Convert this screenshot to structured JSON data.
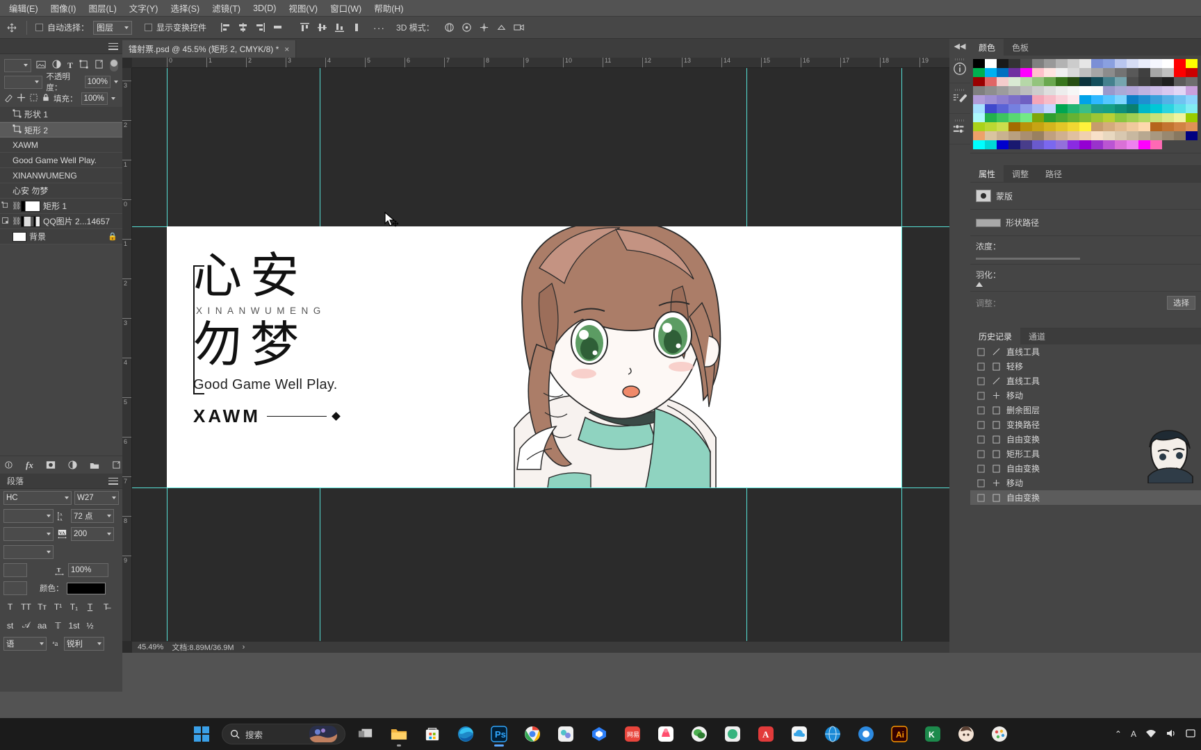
{
  "menubar": {
    "items": [
      {
        "label": "编辑(E)"
      },
      {
        "label": "图像(I)"
      },
      {
        "label": "图层(L)"
      },
      {
        "label": "文字(Y)"
      },
      {
        "label": "选择(S)"
      },
      {
        "label": "滤镜(T)"
      },
      {
        "label": "3D(D)"
      },
      {
        "label": "视图(V)"
      },
      {
        "label": "窗口(W)"
      },
      {
        "label": "帮助(H)"
      }
    ]
  },
  "options_bar": {
    "auto_select_label": "自动选择：",
    "auto_select_value": "图层",
    "show_transform_label": "显示变换控件",
    "mode_3d_label": "3D 模式：",
    "dots_label": "···"
  },
  "document_tab": {
    "title": "镭射票.psd @ 45.5% (矩形 2, CMYK/8) *",
    "close_label": "×"
  },
  "layers_panel": {
    "opacity_label": "不透明度：",
    "opacity_value": "100%",
    "fill_label": "填充：",
    "fill_value": "100%",
    "kind_value": "",
    "items": [
      {
        "name": "形状 1",
        "type": "shape",
        "locked": false
      },
      {
        "name": "矩形 2",
        "type": "shape",
        "selected": true,
        "locked": false
      },
      {
        "name": "XAWM",
        "type": "text",
        "locked": false
      },
      {
        "name": "Good Game Well Play.",
        "type": "text",
        "locked": false
      },
      {
        "name": "XINANWUMENG",
        "type": "text",
        "locked": false
      },
      {
        "name": "心安 勿梦",
        "type": "text",
        "locked": false
      },
      {
        "name": "矩形 1",
        "type": "shape-mask",
        "locked": false
      },
      {
        "name": "QQ图片 2...14657",
        "type": "image-mask",
        "locked": false
      },
      {
        "name": "背景",
        "type": "background",
        "locked": true
      }
    ]
  },
  "character_panel": {
    "tabs": [
      {
        "label": "段落",
        "active": false
      }
    ],
    "font_family": "HC",
    "font_style": "W27",
    "font_size_value": "72 点",
    "tracking_value": "200",
    "vertical_scale_value": "100%",
    "color_label": "颜色：",
    "color_value": "#000000",
    "anti_alias_value": "锐利",
    "language_value": "语",
    "style_buttons": [
      "T",
      "TT",
      "Tᴛ",
      "T¹",
      "T₁",
      "T",
      "T̶"
    ],
    "style_buttons2": [
      "st",
      "𝒜",
      "aa",
      "𝕋",
      "1st",
      "½"
    ]
  },
  "canvas": {
    "zoom_label": "45.49%",
    "doc_size_label": "文档:8.89M/36.9M",
    "ruler_h_ticks": [
      "0",
      "1",
      "2",
      "3",
      "4",
      "5",
      "6",
      "7",
      "8",
      "9",
      "10",
      "11",
      "12",
      "13",
      "14",
      "15",
      "16",
      "17",
      "18",
      "19"
    ],
    "ruler_v_ticks": [
      "3",
      "2",
      "1",
      "0",
      "1",
      "2",
      "3",
      "4",
      "5",
      "6",
      "7",
      "8",
      "9"
    ]
  },
  "artwork": {
    "title_line1": "心安",
    "title_line2": "勿梦",
    "pinyin": "XINANWUMENG",
    "tagline": "Good Game Well Play.",
    "brand": "XAWM"
  },
  "right_dock": {
    "color_tabs": [
      {
        "label": "颜色",
        "active": true
      },
      {
        "label": "色板",
        "active": false
      }
    ],
    "properties_tabs": [
      {
        "label": "属性",
        "active": true
      },
      {
        "label": "调整",
        "active": false
      },
      {
        "label": "路径",
        "active": false
      }
    ],
    "properties": {
      "mask_label": "蒙版",
      "path_label": "形状路径",
      "density_label": "浓度：",
      "feather_label": "羽化：",
      "adjust_label": "调整：",
      "select_button": "选择"
    },
    "history_tabs": [
      {
        "label": "历史记录",
        "active": true
      },
      {
        "label": "通道",
        "active": false
      }
    ],
    "history_items": [
      {
        "label": "直线工具",
        "icon": "line-tool",
        "active": false
      },
      {
        "label": "轻移",
        "icon": "doc",
        "active": false
      },
      {
        "label": "直线工具",
        "icon": "line-tool",
        "active": false
      },
      {
        "label": "移动",
        "icon": "move",
        "active": false
      },
      {
        "label": "删余图层",
        "icon": "doc",
        "active": false
      },
      {
        "label": "变换路径",
        "icon": "doc",
        "active": false
      },
      {
        "label": "自由变换",
        "icon": "doc",
        "active": false
      },
      {
        "label": "矩形工具",
        "icon": "doc",
        "active": false
      },
      {
        "label": "自由变换",
        "icon": "doc",
        "active": false
      },
      {
        "label": "移动",
        "icon": "move",
        "active": false
      },
      {
        "label": "自由变换",
        "icon": "doc",
        "active": true
      }
    ],
    "swatches_row1": [
      "#000000",
      "#ffffff",
      "#1a1a1a",
      "#333333",
      "#4d4d4d",
      "#808080",
      "#999999",
      "#b3b3b3",
      "#cccccc",
      "#e6e6e6",
      "#7b8fd6",
      "#8aa0e0",
      "#b9c6ef",
      "#d6ddf5",
      "#e9edfb",
      "#f5f7fe",
      "#ffffff"
    ],
    "swatches_row2": [
      "#ff0000",
      "#ffff00",
      "#00b050",
      "#00b0f0",
      "#0070c0",
      "#7030a0",
      "#ff00ff",
      "#ffc0cb",
      "#ffe4e1",
      "#f0f0f0",
      "#d9d9d9",
      "#bfbfbf",
      "#a6a6a6",
      "#8c8c8c",
      "#737373",
      "#595959",
      "#404040"
    ],
    "swatches_row3": [
      "#a6a6a6",
      "#bfbfbf",
      "#ff0000",
      "#cc0000",
      "#990000",
      "#e06666",
      "#f4cccc",
      "#d9ead3",
      "#b6d7a8",
      "#93c47d",
      "#6aa84f",
      "#38761d",
      "#274e13",
      "#0c343d",
      "#134f5c",
      "#45818e",
      "#76a5af"
    ],
    "swatches_row4": [
      "#4d4d4d",
      "#3d3d3d",
      "#2e2e2e",
      "#1f1f1f",
      "#5b5b5b",
      "#6e6e6e",
      "#7f7f7f",
      "#8e8e8e",
      "#9c9c9c",
      "#adadad",
      "#bdbdbd",
      "#cdcdcd",
      "#dedede",
      "#ededed",
      "#f6f6f6",
      "#ffffff",
      "#fbfbfb"
    ],
    "swatches_row5": [
      "#9999cc",
      "#a9a9d6",
      "#b3a6d9",
      "#c0b3e0",
      "#cdbde8",
      "#d8c8ef",
      "#e2d6f5",
      "#c9a0dc",
      "#b19cd9",
      "#9f8fd4",
      "#8e7fcf",
      "#7e6fc9",
      "#6f60c2",
      "#f4a6b8",
      "#f7bcc8",
      "#fad2da",
      "#fde8ec"
    ],
    "swatches_row6": [
      "#00a2e8",
      "#2eb8ff",
      "#55c7ff",
      "#7dd6ff",
      "#0b7ec4",
      "#1f8fd0",
      "#3aa0db",
      "#55b1e6",
      "#70c2f1",
      "#8bd3fc",
      "#a6e0ff",
      "#3f48cc",
      "#5a63d6",
      "#7580e0",
      "#909dea",
      "#abb9f4",
      "#c6d6ff"
    ],
    "swatches_row7": [
      "#00a651",
      "#22b573",
      "#3bbf87",
      "#1f9e8a",
      "#16a085",
      "#0f8f7a",
      "#0a7f6e",
      "#00b7c8",
      "#00c8d6",
      "#2bd4e0",
      "#56e0e9",
      "#81ecf2",
      "#acf8fb",
      "#22b14c",
      "#3dc45f",
      "#58d772",
      "#73ea85"
    ],
    "swatches_row8": [
      "#7ea60a",
      "#2f9e2f",
      "#4aa832",
      "#66b233",
      "#81bc34",
      "#9dc635",
      "#b8d036",
      "#8cc63f",
      "#a0cf52",
      "#b4d865",
      "#c8e178",
      "#dcea8b",
      "#f0f39e",
      "#99cc00",
      "#aad21a",
      "#bbd833",
      "#ccde4d"
    ],
    "swatches_row9": [
      "#a36b00",
      "#b9930a",
      "#c7a414",
      "#d5b51e",
      "#e3c628",
      "#f1d732",
      "#fff23c",
      "#c69c6d",
      "#d4ab7d",
      "#e2ba8d",
      "#f0c99d",
      "#fed8ad",
      "#b5651d",
      "#c37430",
      "#d18343",
      "#df9256",
      "#eda169"
    ],
    "swatches_row10": [
      "#d9c4a0",
      "#c9b290",
      "#b9a080",
      "#a98e70",
      "#998060",
      "#c0a080",
      "#d0b090",
      "#e0c0a0",
      "#f0d0b0",
      "#f8e0c8",
      "#e8d8c0",
      "#d8c8b0",
      "#c8b8a0",
      "#b8a890",
      "#a89880",
      "#988870",
      "#887860"
    ],
    "swatches_row11": [
      "#000080",
      "#00ffff",
      "#00d7d7",
      "#0000cd",
      "#191970",
      "#483d8b",
      "#6a5acd",
      "#7b68ee",
      "#9370db",
      "#8a2be2",
      "#9400d3",
      "#9932cc",
      "#ba55d3",
      "#da70d6",
      "#ee82ee",
      "#ff00ff",
      "#ff69b4"
    ]
  },
  "taskbar": {
    "search_placeholder": "搜索",
    "start_label": "start-icon",
    "apps": [
      {
        "name": "task-view-icon"
      },
      {
        "name": "file-explorer-icon"
      },
      {
        "name": "microsoft-store-icon"
      },
      {
        "name": "edge-icon"
      },
      {
        "name": "photoshop-icon",
        "active": true
      },
      {
        "name": "chrome-icon"
      },
      {
        "name": "app-teal-icon"
      },
      {
        "name": "app-blue-icon"
      },
      {
        "name": "app-red-icon"
      },
      {
        "name": "app-pink-icon"
      },
      {
        "name": "wechat-icon"
      },
      {
        "name": "app-green-icon"
      },
      {
        "name": "app-a-icon"
      },
      {
        "name": "app-cloud-icon"
      },
      {
        "name": "app-globe-icon"
      },
      {
        "name": "app-circle-icon"
      },
      {
        "name": "illustrator-icon"
      },
      {
        "name": "kingsoft-icon"
      },
      {
        "name": "avatar-icon"
      },
      {
        "name": "palette-icon"
      }
    ],
    "tray": {
      "chevron": "⌃",
      "lang": "A",
      "network": "network-icon",
      "volume": "volume-icon"
    }
  }
}
